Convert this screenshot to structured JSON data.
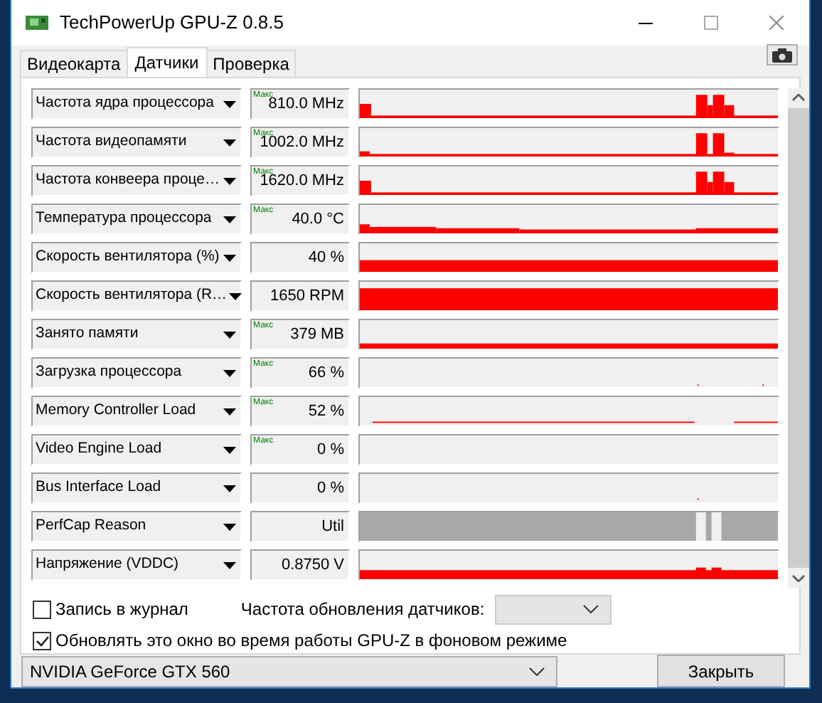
{
  "window": {
    "title": "TechPowerUp GPU-Z 0.8.5"
  },
  "tabs": [
    {
      "label": "Видеокарта",
      "selected": false
    },
    {
      "label": "Датчики",
      "selected": true
    },
    {
      "label": "Проверка",
      "selected": false
    }
  ],
  "sensors": [
    {
      "label": "Частота ядра процессора",
      "badge": "Макс",
      "value": "810.0 MHz",
      "kind": "clock"
    },
    {
      "label": "Частота видеопамяти",
      "badge": "Макс",
      "value": "1002.0 MHz",
      "kind": "clock_mem"
    },
    {
      "label": "Частота конвеера проце…",
      "badge": "Макс",
      "value": "1620.0 MHz",
      "kind": "clock"
    },
    {
      "label": "Температура процессора",
      "badge": "Макс",
      "value": "40.0 °C",
      "kind": "temp"
    },
    {
      "label": "Скорость вентилятора (%)",
      "value": "40 %",
      "kind": "fan_pct"
    },
    {
      "label": "Скорость вентилятора (R…",
      "value": "1650 RPM",
      "kind": "fan_rpm"
    },
    {
      "label": "Занято памяти",
      "badge": "Макс",
      "value": "379 MB",
      "kind": "memory"
    },
    {
      "label": "Загрузка процессора",
      "badge": "Макс",
      "value": "66 %",
      "kind": "dots"
    },
    {
      "label": "Memory Controller Load",
      "badge": "Макс",
      "value": "52 %",
      "kind": "line"
    },
    {
      "label": "Video Engine Load",
      "badge": "Макс",
      "value": "0 %",
      "kind": "empty"
    },
    {
      "label": "Bus Interface Load",
      "value": "0 %",
      "kind": "blip"
    },
    {
      "label": "PerfCap Reason",
      "value": "Util",
      "kind": "perfcap"
    },
    {
      "label": "Напряжение (VDDC)",
      "value": "0.8750 V",
      "kind": "voltage"
    }
  ],
  "options": [
    {
      "label": "Запись в журнал",
      "checked": false
    },
    {
      "label": "Обновлять это окно во время работы GPU-Z в фоновом режиме",
      "checked": true
    }
  ],
  "refresh_rate": {
    "label": "Частота обновления датчиков:"
  },
  "device_select": {
    "value": "NVIDIA GeForce GTX 560"
  },
  "close_button": {
    "label": "Закрыть"
  }
}
